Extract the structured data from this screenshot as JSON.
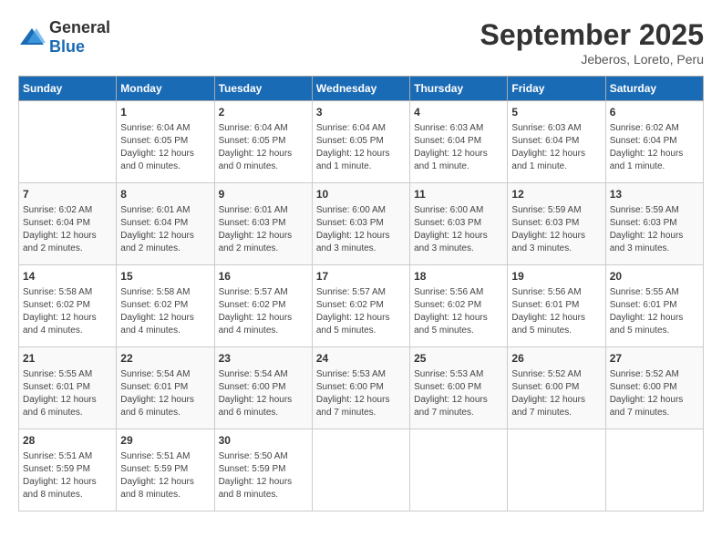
{
  "header": {
    "logo_general": "General",
    "logo_blue": "Blue",
    "month": "September 2025",
    "location": "Jeberos, Loreto, Peru"
  },
  "days_of_week": [
    "Sunday",
    "Monday",
    "Tuesday",
    "Wednesday",
    "Thursday",
    "Friday",
    "Saturday"
  ],
  "weeks": [
    [
      {
        "day": "",
        "content": ""
      },
      {
        "day": "1",
        "content": "Sunrise: 6:04 AM\nSunset: 6:05 PM\nDaylight: 12 hours\nand 0 minutes."
      },
      {
        "day": "2",
        "content": "Sunrise: 6:04 AM\nSunset: 6:05 PM\nDaylight: 12 hours\nand 0 minutes."
      },
      {
        "day": "3",
        "content": "Sunrise: 6:04 AM\nSunset: 6:05 PM\nDaylight: 12 hours\nand 1 minute."
      },
      {
        "day": "4",
        "content": "Sunrise: 6:03 AM\nSunset: 6:04 PM\nDaylight: 12 hours\nand 1 minute."
      },
      {
        "day": "5",
        "content": "Sunrise: 6:03 AM\nSunset: 6:04 PM\nDaylight: 12 hours\nand 1 minute."
      },
      {
        "day": "6",
        "content": "Sunrise: 6:02 AM\nSunset: 6:04 PM\nDaylight: 12 hours\nand 1 minute."
      }
    ],
    [
      {
        "day": "7",
        "content": "Sunrise: 6:02 AM\nSunset: 6:04 PM\nDaylight: 12 hours\nand 2 minutes."
      },
      {
        "day": "8",
        "content": "Sunrise: 6:01 AM\nSunset: 6:04 PM\nDaylight: 12 hours\nand 2 minutes."
      },
      {
        "day": "9",
        "content": "Sunrise: 6:01 AM\nSunset: 6:03 PM\nDaylight: 12 hours\nand 2 minutes."
      },
      {
        "day": "10",
        "content": "Sunrise: 6:00 AM\nSunset: 6:03 PM\nDaylight: 12 hours\nand 3 minutes."
      },
      {
        "day": "11",
        "content": "Sunrise: 6:00 AM\nSunset: 6:03 PM\nDaylight: 12 hours\nand 3 minutes."
      },
      {
        "day": "12",
        "content": "Sunrise: 5:59 AM\nSunset: 6:03 PM\nDaylight: 12 hours\nand 3 minutes."
      },
      {
        "day": "13",
        "content": "Sunrise: 5:59 AM\nSunset: 6:03 PM\nDaylight: 12 hours\nand 3 minutes."
      }
    ],
    [
      {
        "day": "14",
        "content": "Sunrise: 5:58 AM\nSunset: 6:02 PM\nDaylight: 12 hours\nand 4 minutes."
      },
      {
        "day": "15",
        "content": "Sunrise: 5:58 AM\nSunset: 6:02 PM\nDaylight: 12 hours\nand 4 minutes."
      },
      {
        "day": "16",
        "content": "Sunrise: 5:57 AM\nSunset: 6:02 PM\nDaylight: 12 hours\nand 4 minutes."
      },
      {
        "day": "17",
        "content": "Sunrise: 5:57 AM\nSunset: 6:02 PM\nDaylight: 12 hours\nand 5 minutes."
      },
      {
        "day": "18",
        "content": "Sunrise: 5:56 AM\nSunset: 6:02 PM\nDaylight: 12 hours\nand 5 minutes."
      },
      {
        "day": "19",
        "content": "Sunrise: 5:56 AM\nSunset: 6:01 PM\nDaylight: 12 hours\nand 5 minutes."
      },
      {
        "day": "20",
        "content": "Sunrise: 5:55 AM\nSunset: 6:01 PM\nDaylight: 12 hours\nand 5 minutes."
      }
    ],
    [
      {
        "day": "21",
        "content": "Sunrise: 5:55 AM\nSunset: 6:01 PM\nDaylight: 12 hours\nand 6 minutes."
      },
      {
        "day": "22",
        "content": "Sunrise: 5:54 AM\nSunset: 6:01 PM\nDaylight: 12 hours\nand 6 minutes."
      },
      {
        "day": "23",
        "content": "Sunrise: 5:54 AM\nSunset: 6:00 PM\nDaylight: 12 hours\nand 6 minutes."
      },
      {
        "day": "24",
        "content": "Sunrise: 5:53 AM\nSunset: 6:00 PM\nDaylight: 12 hours\nand 7 minutes."
      },
      {
        "day": "25",
        "content": "Sunrise: 5:53 AM\nSunset: 6:00 PM\nDaylight: 12 hours\nand 7 minutes."
      },
      {
        "day": "26",
        "content": "Sunrise: 5:52 AM\nSunset: 6:00 PM\nDaylight: 12 hours\nand 7 minutes."
      },
      {
        "day": "27",
        "content": "Sunrise: 5:52 AM\nSunset: 6:00 PM\nDaylight: 12 hours\nand 7 minutes."
      }
    ],
    [
      {
        "day": "28",
        "content": "Sunrise: 5:51 AM\nSunset: 5:59 PM\nDaylight: 12 hours\nand 8 minutes."
      },
      {
        "day": "29",
        "content": "Sunrise: 5:51 AM\nSunset: 5:59 PM\nDaylight: 12 hours\nand 8 minutes."
      },
      {
        "day": "30",
        "content": "Sunrise: 5:50 AM\nSunset: 5:59 PM\nDaylight: 12 hours\nand 8 minutes."
      },
      {
        "day": "",
        "content": ""
      },
      {
        "day": "",
        "content": ""
      },
      {
        "day": "",
        "content": ""
      },
      {
        "day": "",
        "content": ""
      }
    ]
  ]
}
